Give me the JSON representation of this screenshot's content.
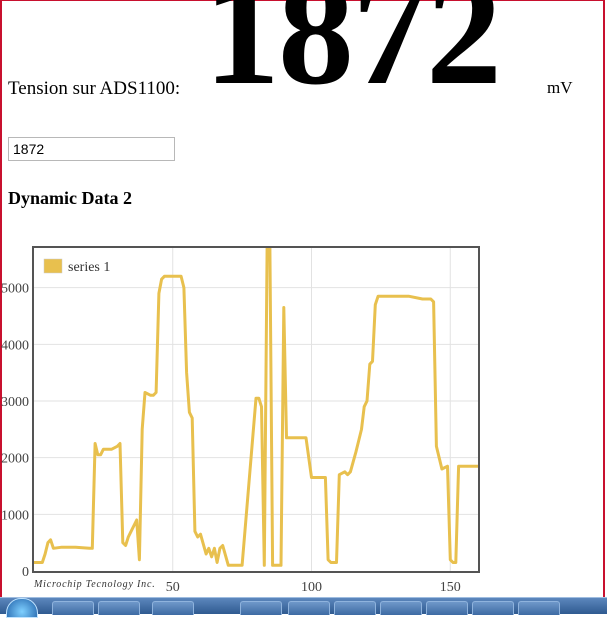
{
  "tension": {
    "label": "Tension sur ADS1100:",
    "value": "1872",
    "unit": "mV"
  },
  "input": {
    "value": "1872"
  },
  "section_title": "Dynamic Data 2",
  "chart_data": {
    "type": "line",
    "title": "",
    "xlabel": "",
    "ylabel": "",
    "xlim": [
      0,
      160
    ],
    "ylim": [
      0,
      5700
    ],
    "grid": true,
    "legend": "top-left",
    "x_ticks": [
      50,
      100,
      150
    ],
    "y_ticks": [
      0,
      1000,
      2000,
      3000,
      4000,
      5000
    ],
    "credit": "Microchip Tecnology Inc.",
    "series": [
      {
        "name": "series 1",
        "color": "#e8c04e",
        "x": [
          0,
          3,
          4,
          5,
          6,
          7,
          10,
          15,
          20,
          21,
          22,
          23,
          24,
          25,
          28,
          30,
          31,
          32,
          33,
          34,
          35,
          36,
          37,
          38,
          39,
          40,
          42,
          43,
          44,
          45,
          46,
          47,
          49,
          50,
          52,
          53,
          54,
          55,
          56,
          57,
          58,
          59,
          60,
          62,
          63,
          64,
          65,
          66,
          67,
          68,
          70,
          71,
          72,
          75,
          80,
          81,
          82,
          83,
          84,
          85,
          86,
          87,
          88,
          89,
          90,
          91,
          92,
          93,
          94,
          95,
          96,
          97,
          98,
          100,
          105,
          106,
          107,
          108,
          109,
          110,
          112,
          113,
          114,
          116,
          117,
          118,
          119,
          120,
          121,
          122,
          123,
          124,
          125,
          128,
          130,
          135,
          140,
          142,
          143,
          144,
          145,
          147,
          149,
          150,
          151,
          152,
          153,
          155,
          158,
          160
        ],
        "y": [
          150,
          150,
          300,
          500,
          550,
          400,
          420,
          420,
          400,
          400,
          2250,
          2050,
          2050,
          2150,
          2150,
          2200,
          2250,
          500,
          450,
          600,
          700,
          800,
          900,
          200,
          2500,
          3150,
          3100,
          3100,
          3150,
          4900,
          5150,
          5200,
          5200,
          5200,
          5200,
          5200,
          5000,
          3500,
          2800,
          2700,
          700,
          600,
          650,
          300,
          400,
          250,
          400,
          150,
          400,
          450,
          100,
          100,
          100,
          100,
          3050,
          3050,
          2900,
          100,
          5700,
          5700,
          100,
          100,
          100,
          100,
          4650,
          2350,
          2350,
          2350,
          2350,
          2350,
          2350,
          2350,
          2350,
          1650,
          1650,
          200,
          150,
          150,
          150,
          1700,
          1750,
          1700,
          1750,
          2100,
          2300,
          2500,
          2900,
          3000,
          3650,
          3700,
          4700,
          4850,
          4850,
          4850,
          4850,
          4850,
          4800,
          4800,
          4800,
          4750,
          2200,
          1800,
          1850,
          200,
          150,
          150,
          1850,
          1850,
          1850,
          1850
        ]
      }
    ]
  }
}
